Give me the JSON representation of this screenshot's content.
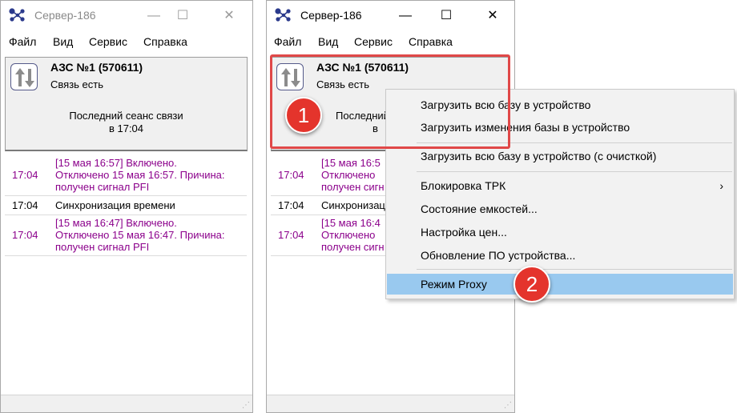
{
  "windows": [
    {
      "title": "Сервер-186",
      "menu": [
        "Файл",
        "Вид",
        "Сервис",
        "Справка"
      ],
      "station": "АЗС №1 (570611)",
      "status": "Связь есть",
      "last_session_line1": "Последний сеанс связи",
      "last_session_line2": "в 17:04",
      "events": [
        {
          "time": "17:04",
          "lines": [
            "[15 мая 16:57] Включено.",
            "Отключено 15 мая 16:57. Причина:",
            "получен сигнал PFI"
          ]
        },
        {
          "time": "17:04",
          "lines": [
            "Синхронизация времени"
          ]
        },
        {
          "time": "17:04",
          "lines": [
            "[15 мая 16:47] Включено.",
            "Отключено 15 мая 16:47. Причина:",
            "получен сигнал PFI"
          ]
        }
      ]
    },
    {
      "title": "Сервер-186",
      "menu": [
        "Файл",
        "Вид",
        "Сервис",
        "Справка"
      ],
      "station": "АЗС №1 (570611)",
      "status": "Связь есть",
      "last_session_line1": "Последний",
      "last_session_line2": "в",
      "events": [
        {
          "time": "17:04",
          "lines": [
            "[15 мая 16:5",
            "Отключено",
            "получен сигн"
          ]
        },
        {
          "time": "17:04",
          "lines": [
            "Синхронизаци"
          ]
        },
        {
          "time": "17:04",
          "lines": [
            "[15 мая 16:4",
            "Отключено",
            "получен сигн"
          ]
        }
      ]
    }
  ],
  "caption_buttons": {
    "minimize": "—",
    "maximize": "☐",
    "close": "✕"
  },
  "context_menu": {
    "items": [
      {
        "label": "Загрузить всю базу в устройство"
      },
      {
        "label": "Загрузить изменения базы в устройство"
      },
      {
        "label": "Загрузить всю базу в устройство (с очисткой)"
      },
      {
        "label": "Блокировка ТРК",
        "submenu": "›"
      },
      {
        "label": "Состояние емкостей..."
      },
      {
        "label": "Настройка цен..."
      },
      {
        "label": "Обновление ПО устройства..."
      },
      {
        "label": "Режим Proxy",
        "highlighted": true
      }
    ]
  },
  "callouts": [
    "1",
    "2"
  ],
  "colors": {
    "event_warning": "#8b008b",
    "annotation_red": "#e4342c",
    "menu_highlight": "#99c9ef",
    "app_icon": "#2b3a8c"
  },
  "icons": {
    "app": "network-nodes-icon",
    "sync": "up-down-arrows-icon",
    "grip": "resize-grip-icon"
  }
}
